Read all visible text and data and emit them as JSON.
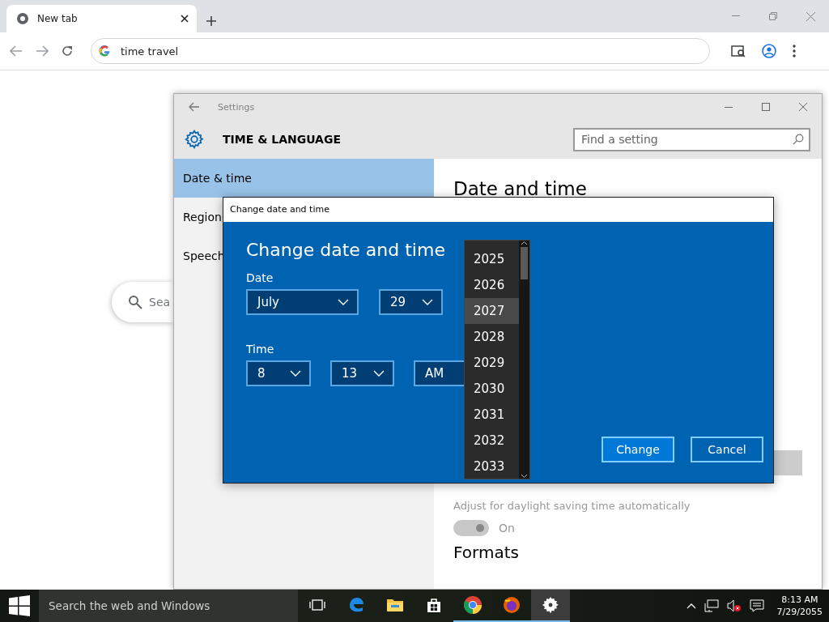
{
  "browser": {
    "tab": {
      "title": "New tab"
    },
    "address_bar": {
      "value": "time travel"
    },
    "page_search": {
      "placeholder": "Sea"
    }
  },
  "settings": {
    "title": "Settings",
    "header": "TIME & LANGUAGE",
    "search": {
      "placeholder": "Find a setting"
    },
    "nav": [
      {
        "label": "Date & time",
        "selected": true
      },
      {
        "label": "Region",
        "selected": false
      },
      {
        "label": "Speech",
        "selected": false
      }
    ],
    "page_title": "Date and time",
    "daylight": {
      "label": "Adjust for daylight saving time automatically",
      "toggle": {
        "on": true,
        "disabled": true,
        "label": "On"
      }
    },
    "section_heading": "Formats"
  },
  "dialog": {
    "title": "Change date and time",
    "heading": "Change date and time",
    "date_label": "Date",
    "date_fields": [
      {
        "value": "July"
      },
      {
        "value": "29"
      }
    ],
    "time_label": "Time",
    "time_fields": [
      {
        "value": "8"
      },
      {
        "value": "13"
      },
      {
        "value": "AM"
      }
    ],
    "year_list": {
      "items": [
        {
          "label": "2025",
          "hovered": false
        },
        {
          "label": "2026",
          "hovered": false
        },
        {
          "label": "2027",
          "hovered": true
        },
        {
          "label": "2028",
          "hovered": false
        },
        {
          "label": "2029",
          "hovered": false
        },
        {
          "label": "2030",
          "hovered": false
        },
        {
          "label": "2031",
          "hovered": false
        },
        {
          "label": "2032",
          "hovered": false
        },
        {
          "label": "2033",
          "hovered": false
        }
      ]
    },
    "buttons": [
      "Change",
      "Cancel"
    ]
  },
  "taskbar": {
    "search_placeholder": "Search the web and Windows",
    "apps": [
      {
        "kind": "taskview",
        "running": false,
        "active": false
      },
      {
        "kind": "edge",
        "running": false,
        "active": false
      },
      {
        "kind": "explorer",
        "running": false,
        "active": false
      },
      {
        "kind": "store",
        "running": false,
        "active": false
      },
      {
        "kind": "chrome",
        "running": true,
        "active": false
      },
      {
        "kind": "firefox",
        "running": true,
        "active": false
      },
      {
        "kind": "settings",
        "running": true,
        "active": true
      }
    ],
    "clock": {
      "time": "8:13 AM",
      "date": "7/29/2055"
    }
  }
}
